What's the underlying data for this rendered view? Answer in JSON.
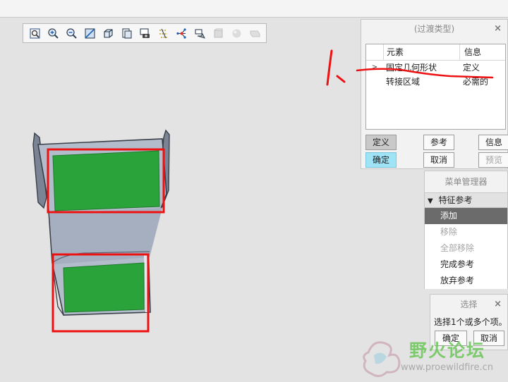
{
  "toolbar": {
    "buttons": [
      {
        "icon": "refit-icon",
        "enabled": true
      },
      {
        "icon": "zoom-in-icon",
        "enabled": true
      },
      {
        "icon": "zoom-out-icon",
        "enabled": true
      },
      {
        "icon": "repaint-icon",
        "enabled": true
      },
      {
        "icon": "display-style-icon",
        "enabled": true
      },
      {
        "icon": "saved-orientations-icon",
        "enabled": true
      },
      {
        "icon": "view-manager-icon",
        "enabled": true
      },
      {
        "icon": "datum-display-icon",
        "enabled": true
      },
      {
        "icon": "spin-center-icon",
        "enabled": true
      },
      {
        "icon": "annotation-display-icon",
        "enabled": true
      },
      {
        "icon": "appearance-icon",
        "enabled": false
      },
      {
        "icon": "sphere-icon",
        "enabled": false
      },
      {
        "icon": "section-icon",
        "enabled": false
      }
    ]
  },
  "transition_dialog": {
    "title": "(过渡类型)",
    "close": "×",
    "columns": [
      "元素",
      "信息"
    ],
    "rows": [
      {
        "expander": ">",
        "element": "固定几何形状",
        "info": "定义"
      },
      {
        "expander": "",
        "element": "转接区域",
        "info": "必需的"
      }
    ],
    "buttons": {
      "define": "定义",
      "reference": "参考",
      "info": "信息",
      "ok": "确定",
      "cancel": "取消",
      "preview": "预览"
    }
  },
  "menu_manager": {
    "title": "菜单管理器",
    "section": "特征参考",
    "items": [
      {
        "label": "添加",
        "state": "selected"
      },
      {
        "label": "移除",
        "state": "disabled"
      },
      {
        "label": "全部移除",
        "state": "disabled"
      },
      {
        "label": "完成参考",
        "state": "enabled"
      },
      {
        "label": "放弃参考",
        "state": "enabled"
      }
    ]
  },
  "select_dialog": {
    "title": "选择",
    "close": "×",
    "message": "选择1个或多个项。",
    "ok": "确定",
    "cancel": "取消"
  },
  "watermark": {
    "title": "野火论坛",
    "url": "www.proewildfire.cn"
  },
  "annotation": {
    "marker": "1、"
  },
  "colors": {
    "selected_surface": "#2aa43a",
    "highlight_box": "#ee1111",
    "active_button": "#9fe3f7",
    "model_body": "#a9b5c6"
  }
}
